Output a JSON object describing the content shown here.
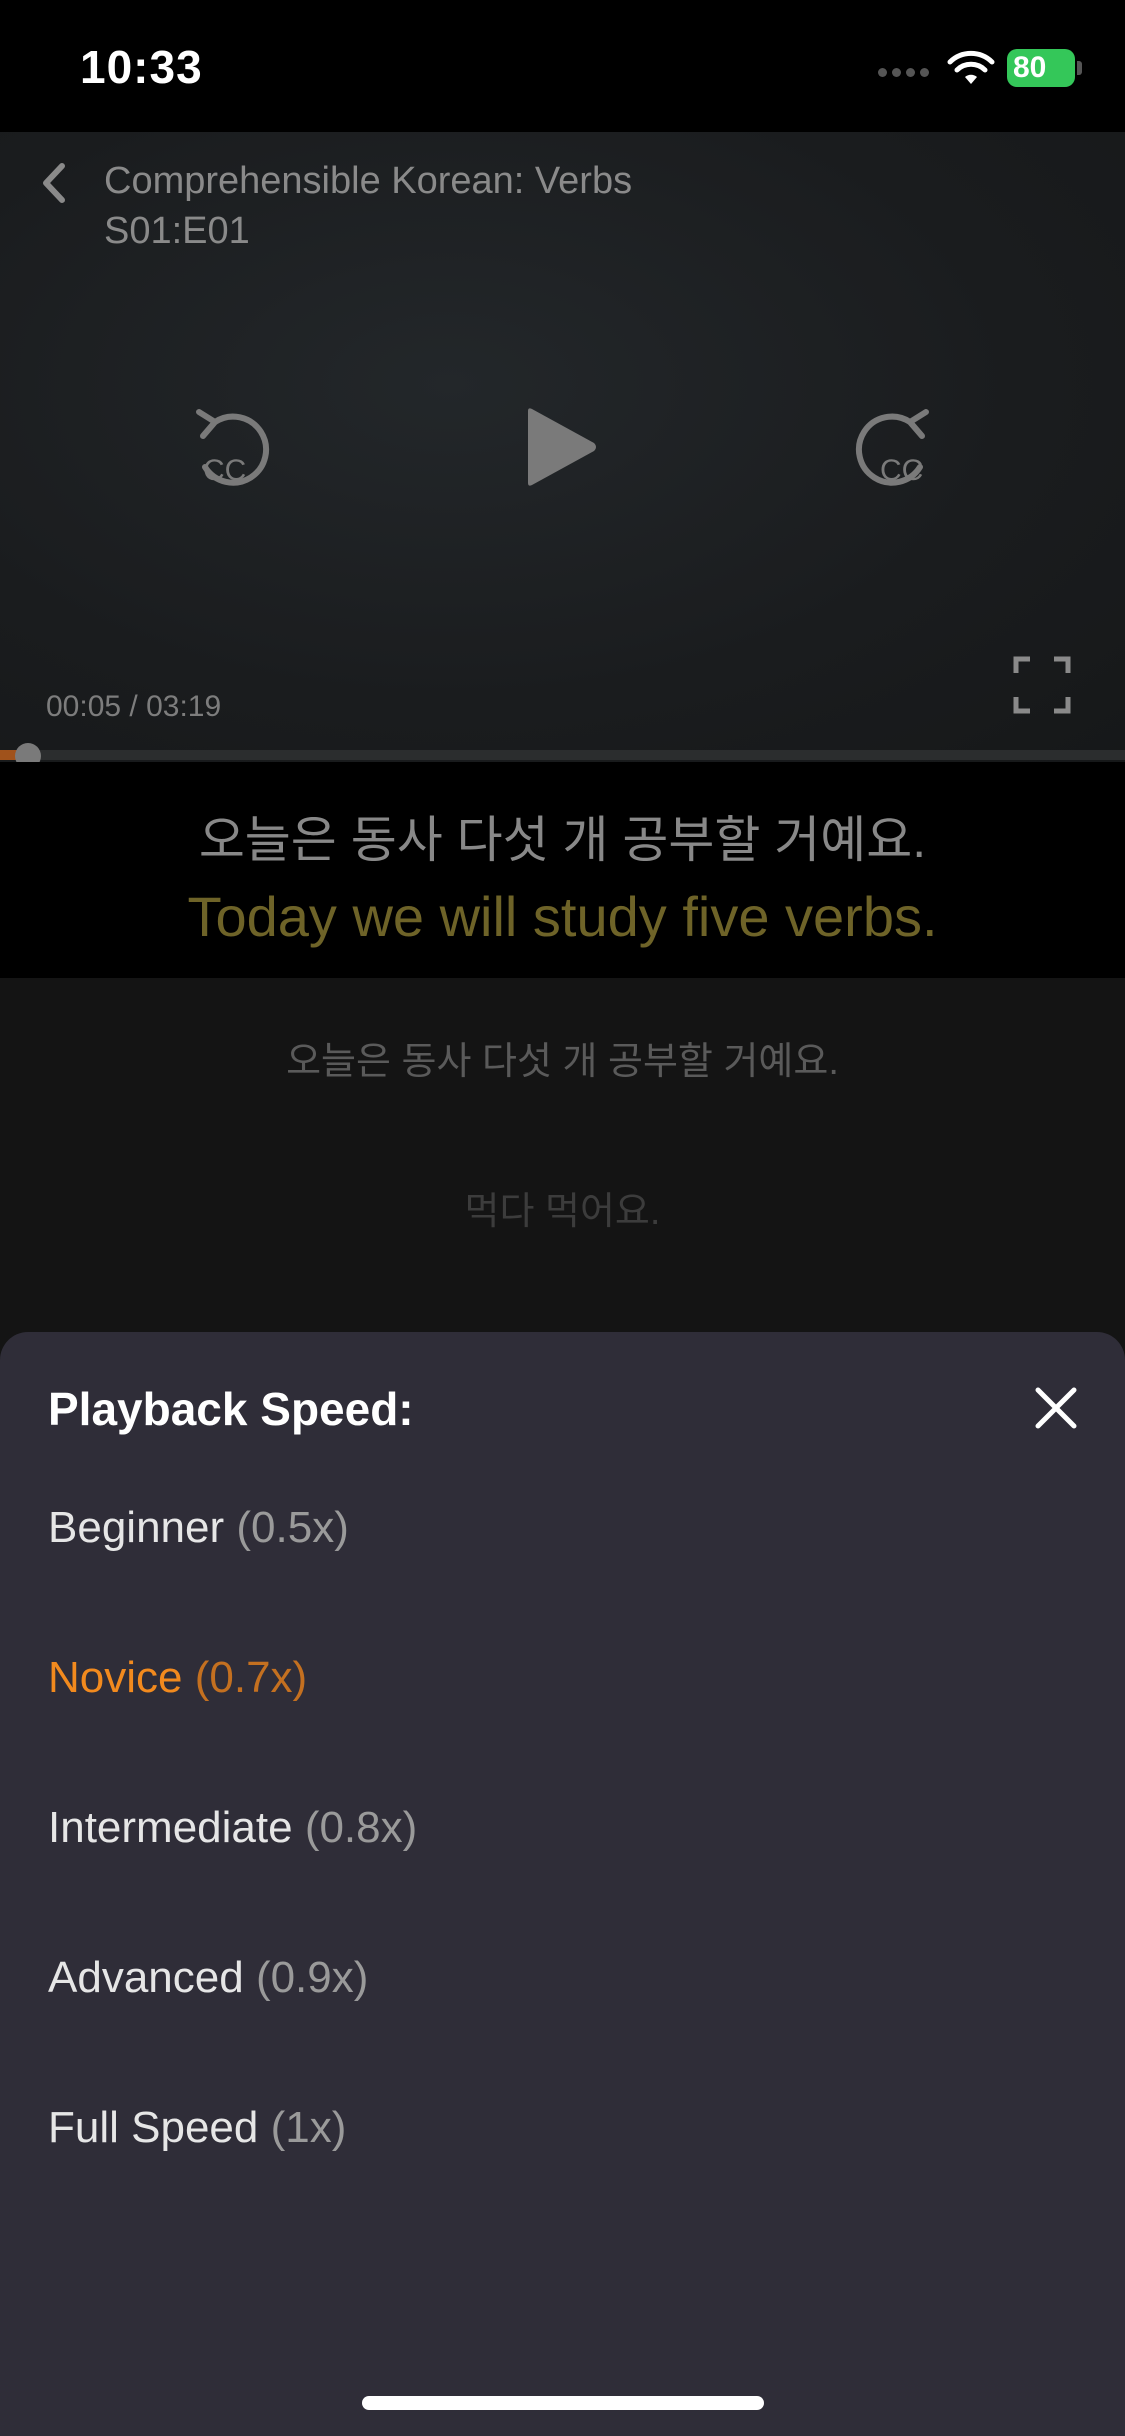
{
  "status": {
    "time": "10:33",
    "battery": "80"
  },
  "video": {
    "title": "Comprehensible Korean: Verbs",
    "episode": "S01:E01",
    "elapsed": "00:05",
    "duration": "03:19",
    "time_readout": "00:05 / 03:19",
    "progress_fraction": 0.025
  },
  "subtitles": {
    "korean": "오늘은 동사 다섯 개 공부할 거예요.",
    "english": "Today we will study five verbs."
  },
  "transcript": {
    "lines": [
      "오늘은 동사 다섯 개 공부할 거예요.",
      "먹다 먹어요."
    ]
  },
  "speed_sheet": {
    "title": "Playback Speed:",
    "options": [
      {
        "label": "Beginner",
        "multiplier": "(0.5x)"
      },
      {
        "label": "Novice",
        "multiplier": "(0.7x)",
        "selected": true
      },
      {
        "label": "Intermediate",
        "multiplier": "(0.8x)"
      },
      {
        "label": "Advanced",
        "multiplier": "(0.9x)"
      },
      {
        "label": "Full Speed",
        "multiplier": "(1x)"
      }
    ]
  },
  "colors": {
    "accent": "#f28a1e",
    "sheet_bg": "#2f2d38",
    "subtitle_en": "#6e6328"
  },
  "icons": [
    "back-icon",
    "rewind-cc-icon",
    "play-icon",
    "forward-cc-icon",
    "fullscreen-icon",
    "close-icon",
    "wifi-icon",
    "battery-icon"
  ]
}
